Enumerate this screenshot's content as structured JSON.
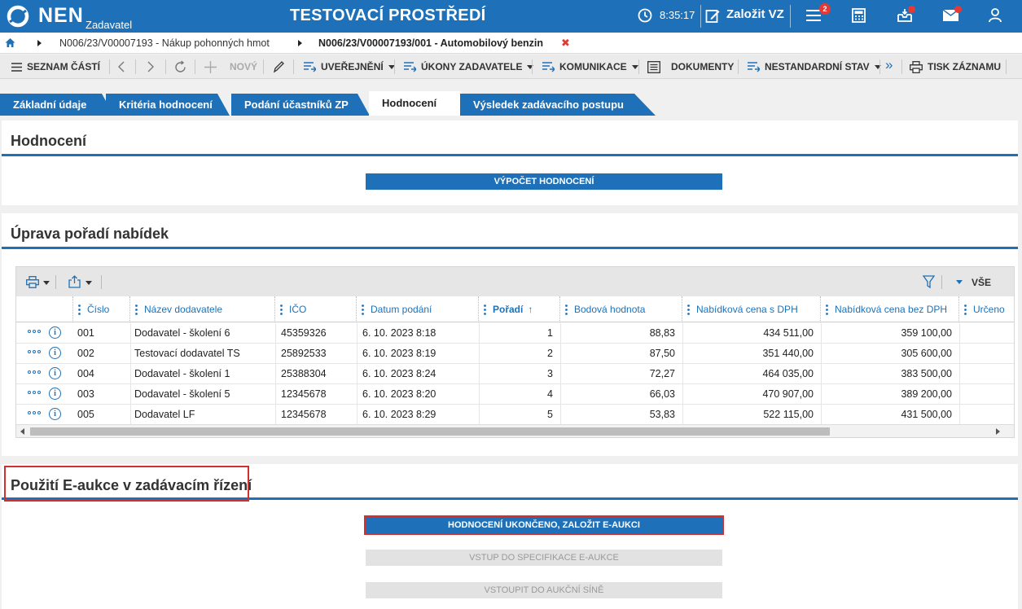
{
  "app": {
    "logo": "NEN",
    "logo_sub": "Zadavatel",
    "environment": "TESTOVACÍ PROSTŘEDÍ",
    "time": "8:35:17",
    "create_label": "Založit VZ",
    "tasks_badge": "2"
  },
  "breadcrumb": {
    "item1": "N006/23/V00007193 - Nákup pohonných hmot",
    "item2": "N006/23/V00007193/001 - Automobilový benzin",
    "close": "✖"
  },
  "toolbar": {
    "list_parts": "SEZNAM ČÁSTÍ",
    "new": "NOVÝ",
    "publish": "UVEŘEJNĚNÍ",
    "acts": "ÚKONY ZADAVATELE",
    "communication": "KOMUNIKACE",
    "documents": "DOKUMENTY",
    "nonstandard": "NESTANDARDNÍ STAV",
    "more": "»",
    "print": "TISK ZÁZNAMU"
  },
  "tabs": [
    "Základní údaje",
    "Kritéria hodnocení",
    "Podání účastníků ZP",
    "Hodnocení",
    "Výsledek zadávacího postupu"
  ],
  "section1": {
    "title": "Hodnocení",
    "button": "VÝPOČET HODNOCENÍ"
  },
  "section2": {
    "title": "Úprava pořadí nabídek",
    "filter_all": "VŠE",
    "columns": [
      "Číslo",
      "Název dodavatele",
      "IČO",
      "Datum podání",
      "Pořadí",
      "Bodová hodnota",
      "Nabídková cena s DPH",
      "Nabídková cena bez DPH",
      "Určeno"
    ],
    "sort_indicator": "↑",
    "rows": [
      {
        "cislo": "001",
        "nazev": "Dodavatel - školení 6",
        "ico": "45359326",
        "datum": "6. 10. 2023 8:18",
        "poradi": "1",
        "body": "88,83",
        "s_dph": "434 511,00",
        "bez_dph": "359 100,00"
      },
      {
        "cislo": "002",
        "nazev": "Testovací dodavatel TS",
        "ico": "25892533",
        "datum": "6. 10. 2023 8:19",
        "poradi": "2",
        "body": "87,50",
        "s_dph": "351 440,00",
        "bez_dph": "305 600,00"
      },
      {
        "cislo": "004",
        "nazev": "Dodavatel - školení 1",
        "ico": "25388304",
        "datum": "6. 10. 2023 8:24",
        "poradi": "3",
        "body": "72,27",
        "s_dph": "464 035,00",
        "bez_dph": "383 500,00"
      },
      {
        "cislo": "003",
        "nazev": "Dodavatel - školení 5",
        "ico": "12345678",
        "datum": "6. 10. 2023 8:20",
        "poradi": "4",
        "body": "66,03",
        "s_dph": "470 907,00",
        "bez_dph": "389 200,00"
      },
      {
        "cislo": "005",
        "nazev": "Dodavatel LF",
        "ico": "12345678",
        "datum": "6. 10. 2023 8:29",
        "poradi": "5",
        "body": "53,83",
        "s_dph": "522 115,00",
        "bez_dph": "431 500,00"
      }
    ]
  },
  "section3": {
    "title": "Použití E-aukce v zadávacím řízení",
    "btn_primary": "HODNOCENÍ UKONČENO, ZALOŽIT E-AUKCI",
    "btn_spec": "VSTUP DO SPECIFIKACE E-AUKCE",
    "btn_hall": "VSTOUPIT DO AUKČNÍ SÍNĚ"
  },
  "colors": {
    "primary": "#1e71b8",
    "highlight": "#d32f2f",
    "badge": "#e53935"
  }
}
